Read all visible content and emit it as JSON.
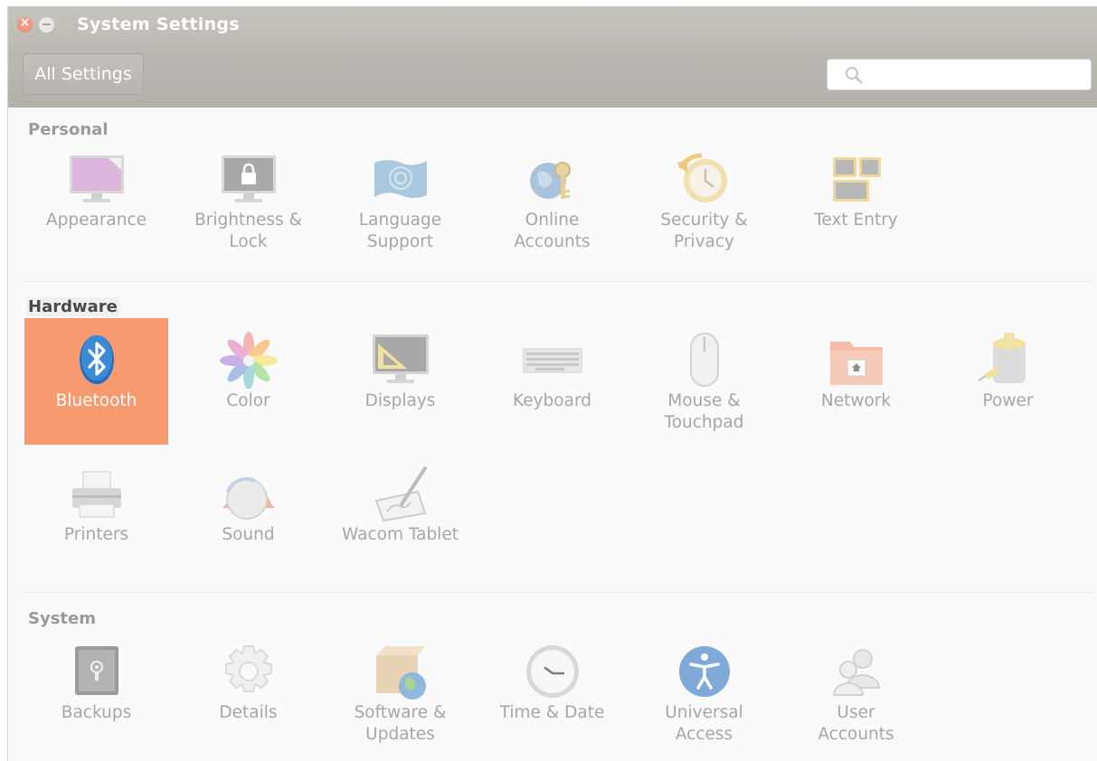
{
  "window": {
    "title": "System Settings"
  },
  "toolbar": {
    "all_settings_label": "All Settings",
    "search": {
      "value": "",
      "placeholder": ""
    }
  },
  "sections": [
    {
      "title": "Personal",
      "items": [
        {
          "label": "Appearance",
          "icon": "appearance-icon"
        },
        {
          "label": "Brightness &\nLock",
          "icon": "brightness-lock-icon"
        },
        {
          "label": "Language\nSupport",
          "icon": "language-support-icon"
        },
        {
          "label": "Online\nAccounts",
          "icon": "online-accounts-icon"
        },
        {
          "label": "Security &\nPrivacy",
          "icon": "security-privacy-icon"
        },
        {
          "label": "Text Entry",
          "icon": "text-entry-icon"
        }
      ]
    },
    {
      "title": "Hardware",
      "items": [
        {
          "label": "Bluetooth",
          "icon": "bluetooth-icon",
          "selected": true
        },
        {
          "label": "Color",
          "icon": "color-icon"
        },
        {
          "label": "Displays",
          "icon": "displays-icon"
        },
        {
          "label": "Keyboard",
          "icon": "keyboard-icon"
        },
        {
          "label": "Mouse &\nTouchpad",
          "icon": "mouse-touchpad-icon"
        },
        {
          "label": "Network",
          "icon": "network-icon"
        },
        {
          "label": "Power",
          "icon": "power-icon"
        },
        {
          "label": "Printers",
          "icon": "printers-icon"
        },
        {
          "label": "Sound",
          "icon": "sound-icon"
        },
        {
          "label": "Wacom Tablet",
          "icon": "wacom-tablet-icon"
        }
      ]
    },
    {
      "title": "System",
      "items": [
        {
          "label": "Backups",
          "icon": "backups-icon"
        },
        {
          "label": "Details",
          "icon": "details-icon"
        },
        {
          "label": "Software &\nUpdates",
          "icon": "software-updates-icon"
        },
        {
          "label": "Time & Date",
          "icon": "time-date-icon"
        },
        {
          "label": "Universal\nAccess",
          "icon": "universal-access-icon"
        },
        {
          "label": "User\nAccounts",
          "icon": "user-accounts-icon"
        }
      ]
    }
  ],
  "colors": {
    "titlebar": "#c2bfb9",
    "selected": "#f79a6f",
    "label": "#a6a6a6"
  }
}
